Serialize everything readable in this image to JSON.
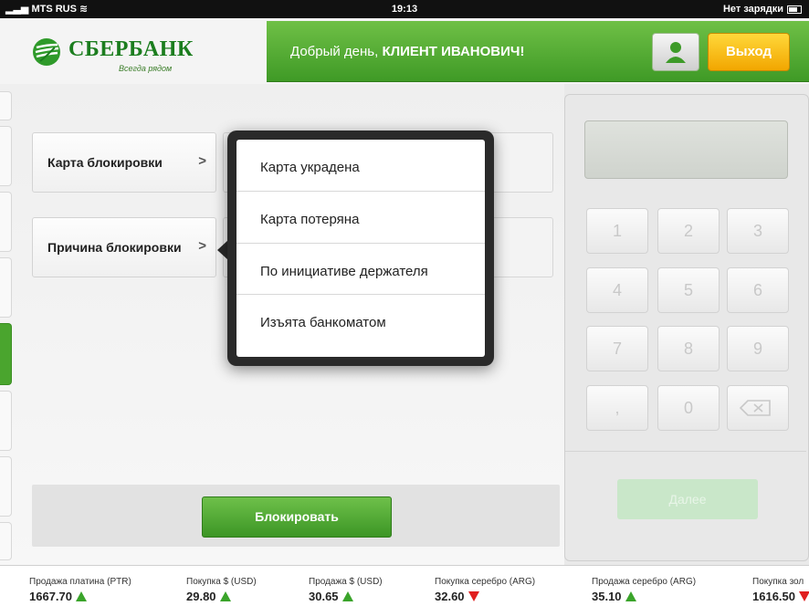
{
  "status_bar": {
    "carrier": "MTS RUS",
    "time": "19:13",
    "battery_text": "Нет зарядки"
  },
  "header": {
    "bank_name": "СБЕРБАНК",
    "slogan": "Всегда рядом",
    "greeting_prefix": "Добрый день, ",
    "greeting_name": "КЛИЕНТ ИВАНОВИЧ!",
    "exit_label": "Выход",
    "accent_color": "#4aa52e"
  },
  "form": {
    "card_label": "Карта блокировки",
    "reason_label": "Причина блокировки",
    "chevron": ">",
    "block_button": "Блокировать"
  },
  "popover": {
    "options": [
      "Карта украдена",
      "Карта потеряна",
      "По инициативе держателя",
      "Изъята банкоматом"
    ]
  },
  "keypad": {
    "keys": [
      "1",
      "2",
      "3",
      "4",
      "5",
      "6",
      "7",
      "8",
      "9",
      ",",
      "0"
    ],
    "backspace_icon": "backspace-icon",
    "next_label": "Далее"
  },
  "ticker": [
    {
      "label": "Продажа платина (PTR)",
      "value": "1667.70",
      "trend": "up"
    },
    {
      "label": "Покупка $ (USD)",
      "value": "29.80",
      "trend": "up"
    },
    {
      "label": "Продажа $ (USD)",
      "value": "30.65",
      "trend": "up"
    },
    {
      "label": "Покупка серебро (ARG)",
      "value": "32.60",
      "trend": "down"
    },
    {
      "label": "Продажа серебро (ARG)",
      "value": "35.10",
      "trend": "up"
    },
    {
      "label": "Покупка зол",
      "value": "1616.50",
      "trend": "down"
    }
  ]
}
